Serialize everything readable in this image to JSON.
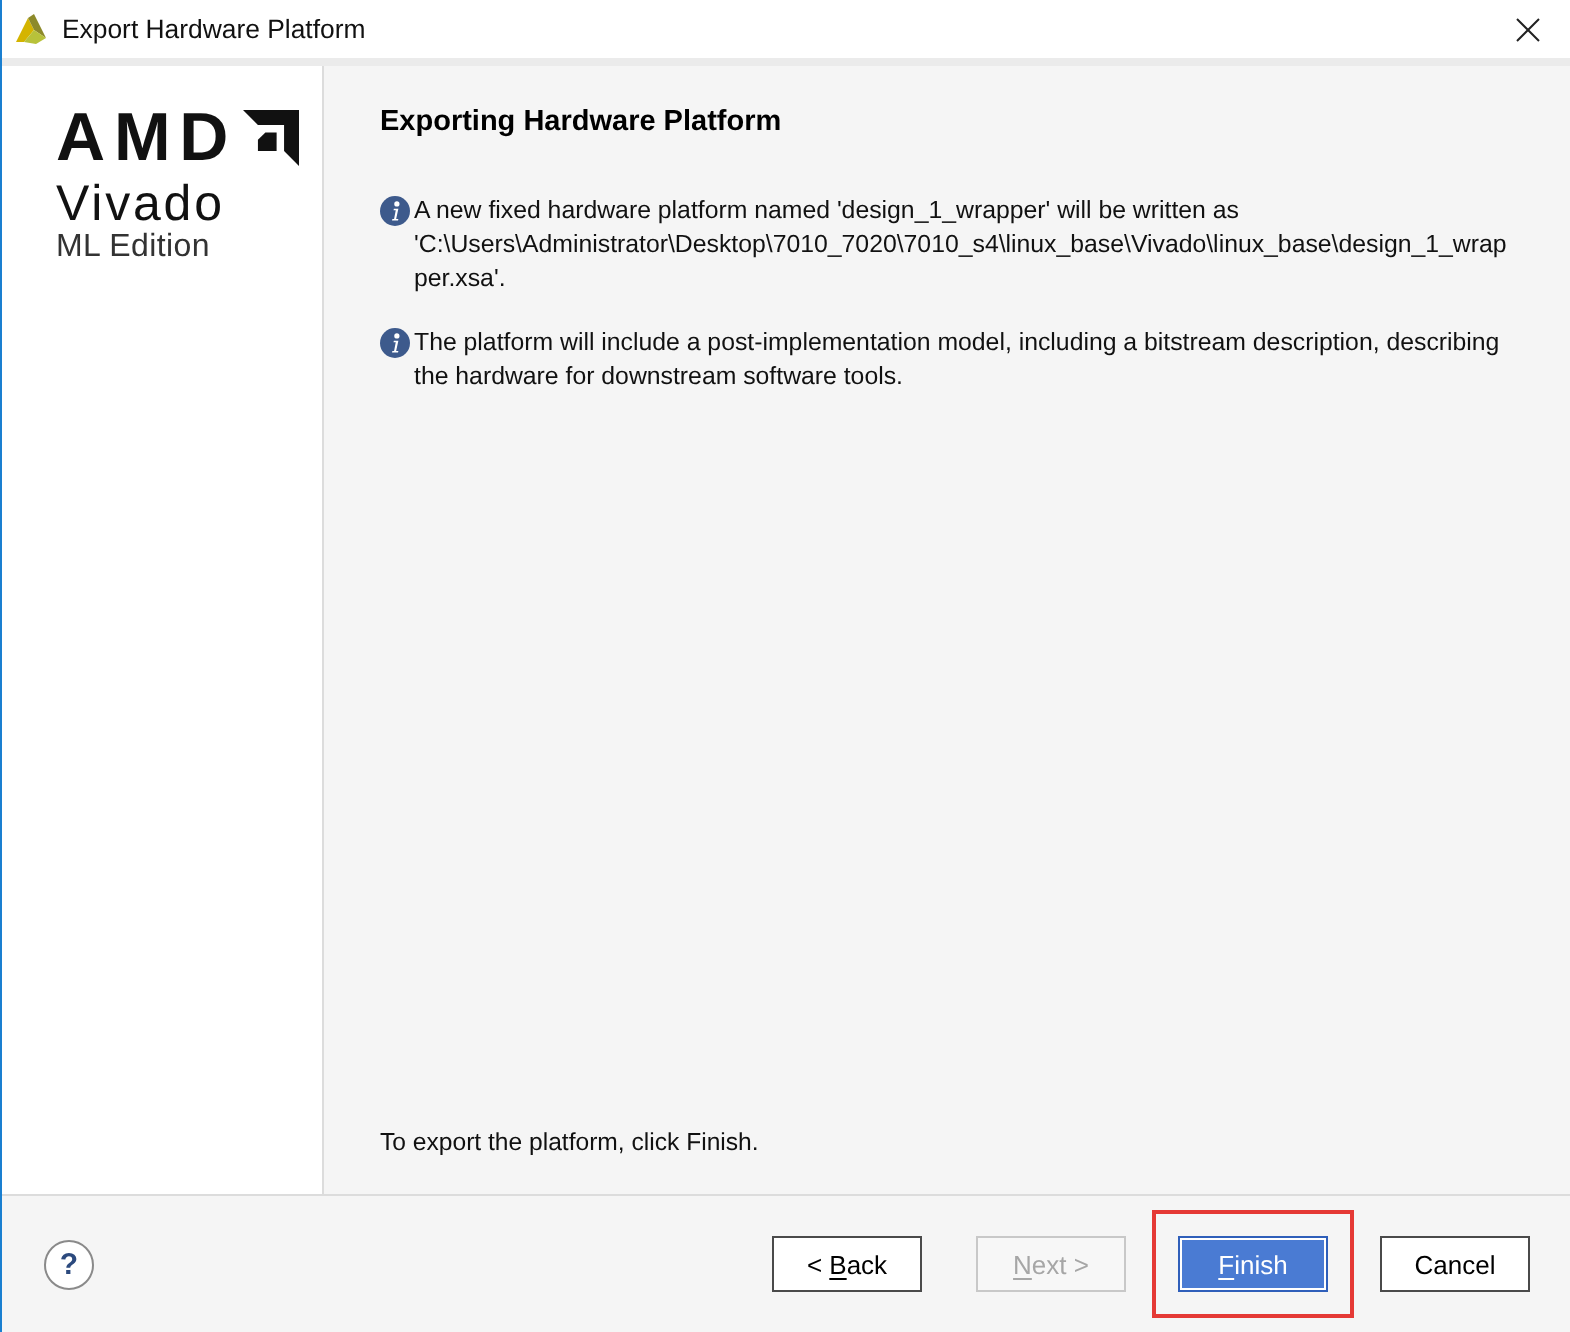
{
  "window": {
    "title": "Export Hardware Platform"
  },
  "logo": {
    "brand": "AMD",
    "product": "Vivado",
    "edition": "ML Edition"
  },
  "page": {
    "heading": "Exporting Hardware Platform",
    "messages": [
      {
        "kind": "info",
        "text": "A new fixed hardware platform named 'design_1_wrapper' will be written as 'C:\\Users\\Administrator\\Desktop\\7010_7020\\7010_s4\\linux_base\\Vivado\\linux_base\\design_1_wrapper.xsa'."
      },
      {
        "kind": "info",
        "text": "The platform will include a post-implementation model, including a bitstream description, describing the hardware for downstream software tools."
      }
    ],
    "footer_text": "To export the platform, click Finish."
  },
  "help_button": {
    "label": "?"
  },
  "buttons": [
    {
      "label": "< Back",
      "mnemonic_underlined": true,
      "disabled": false,
      "primary": false,
      "highlighted": false
    },
    {
      "label": "Next >",
      "mnemonic_underlined": true,
      "disabled": true,
      "primary": false,
      "highlighted": false
    },
    {
      "label": "Finish",
      "mnemonic_underlined": true,
      "disabled": false,
      "primary": true,
      "highlighted": true
    },
    {
      "label": "Cancel",
      "mnemonic_underlined": false,
      "disabled": false,
      "primary": false,
      "highlighted": false
    }
  ]
}
